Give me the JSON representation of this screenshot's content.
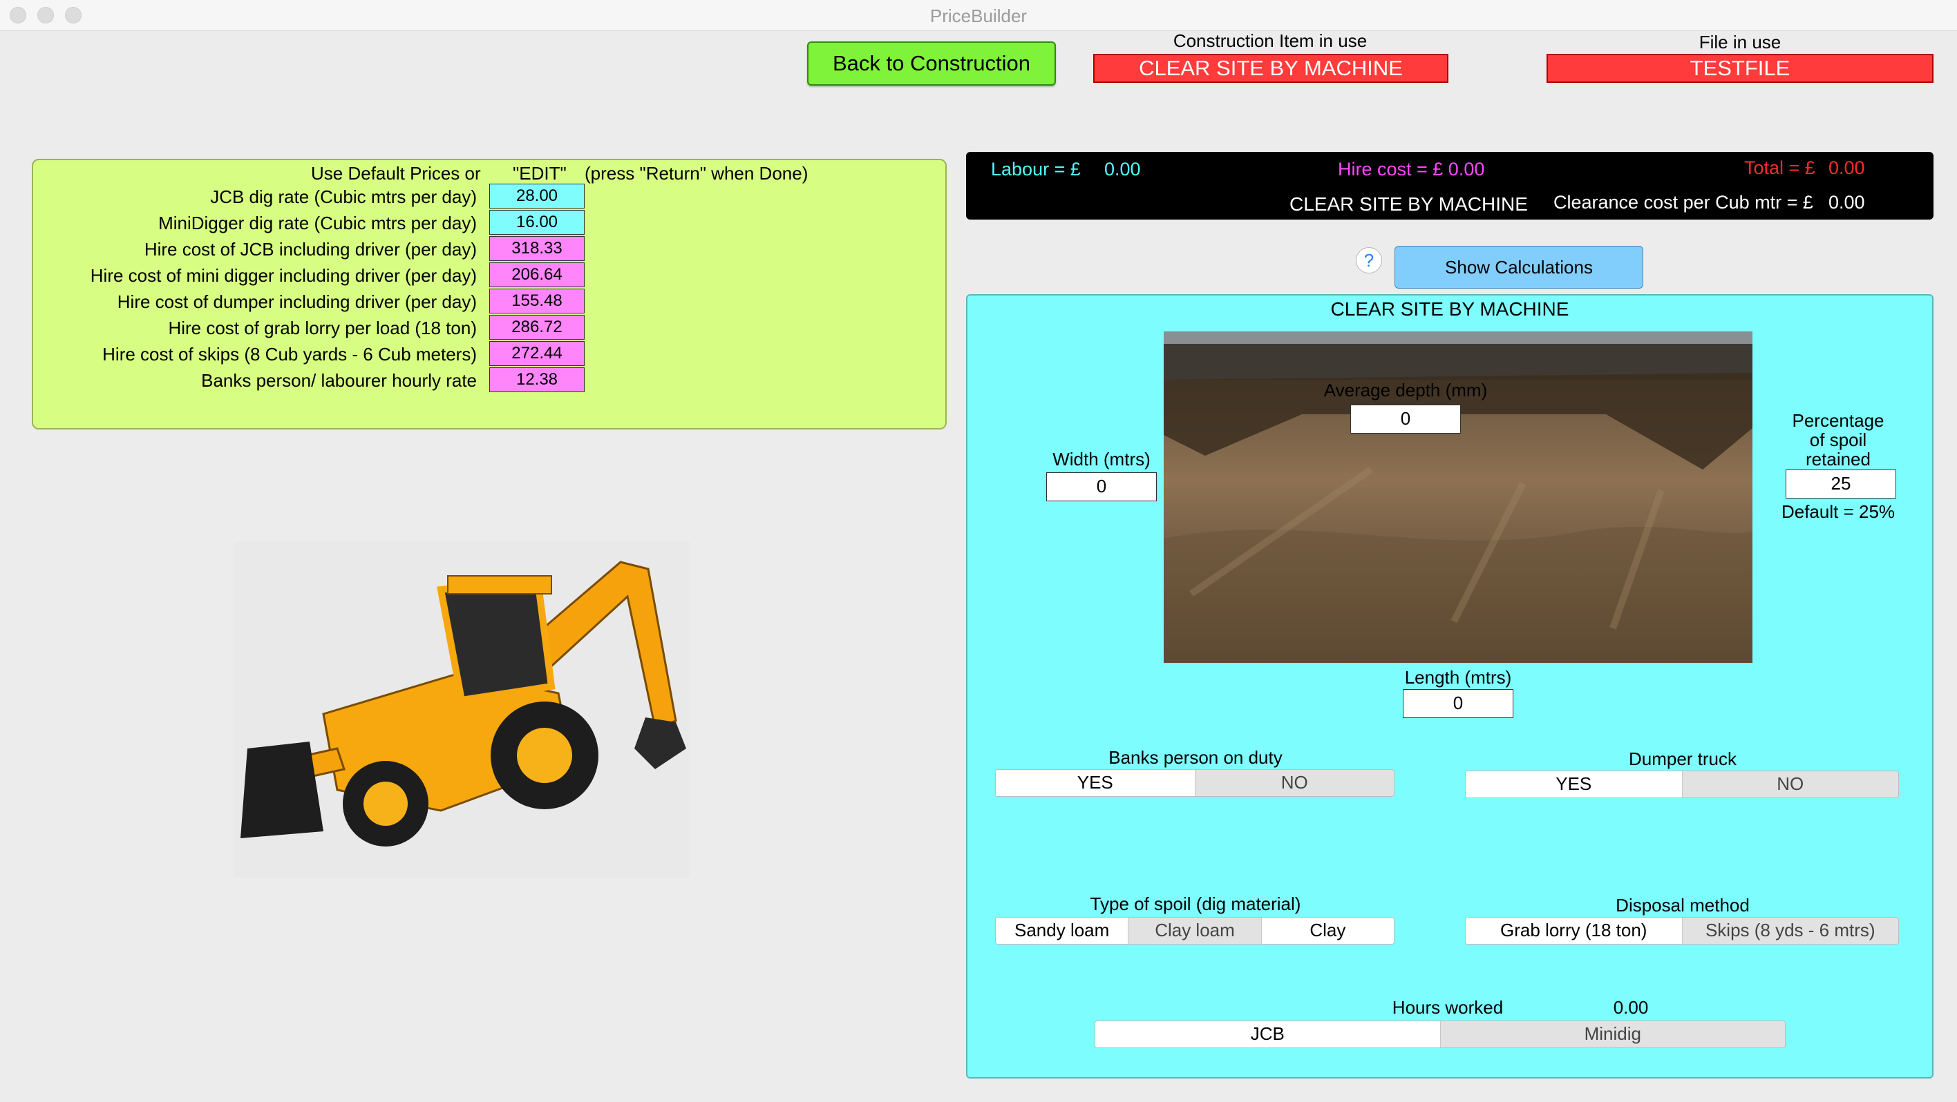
{
  "window": {
    "title": "PriceBuilder"
  },
  "header": {
    "back_button": "Back to Construction",
    "construction_item_label": "Construction Item in use",
    "construction_item_value": "CLEAR SITE BY MACHINE",
    "file_label": "File in use",
    "file_value": "TESTFILE"
  },
  "prices": {
    "header_left": "Use Default Prices or",
    "header_edit": "\"EDIT\"",
    "header_hint": "(press \"Return\" when Done)",
    "rows": [
      {
        "label": "JCB dig rate (Cubic mtrs per day)",
        "value": "28.00"
      },
      {
        "label": "MiniDigger dig rate (Cubic mtrs per day)",
        "value": "16.00"
      },
      {
        "label": "Hire cost of JCB including driver (per day)",
        "value": "318.33"
      },
      {
        "label": "Hire cost of mini digger including driver (per day)",
        "value": "206.64"
      },
      {
        "label": "Hire cost of dumper including driver (per day)",
        "value": "155.48"
      },
      {
        "label": "Hire cost of grab lorry per load (18 ton)",
        "value": "286.72"
      },
      {
        "label": "Hire cost of skips (8 Cub yards - 6 Cub meters)",
        "value": "272.44"
      },
      {
        "label": "Banks person/ labourer hourly rate",
        "value": "12.38"
      }
    ]
  },
  "summary": {
    "labour_label": "Labour = £",
    "labour_value": "0.00",
    "hire_label": "Hire cost = £ 0.00",
    "total_label": "Total = £",
    "total_value": "0.00",
    "item_name": "CLEAR SITE BY MACHINE",
    "clearance_label": "Clearance cost per Cub mtr = £",
    "clearance_value": "0.00"
  },
  "help": {
    "glyph": "?"
  },
  "show_calc_button": "Show Calculations",
  "site": {
    "title": "CLEAR SITE BY MACHINE",
    "depth_label": "Average depth (mm)",
    "depth_value": "0",
    "width_label": "Width (mtrs)",
    "width_value": "0",
    "length_label": "Length (mtrs)",
    "length_value": "0",
    "pct_label_1": "Percentage",
    "pct_label_2": "of spoil",
    "pct_label_3": "retained",
    "pct_value": "25",
    "pct_default": "Default = 25%"
  },
  "banks": {
    "label": "Banks person on duty",
    "yes": "YES",
    "no": "NO"
  },
  "dumper": {
    "label": "Dumper truck",
    "yes": "YES",
    "no": "NO"
  },
  "spoil": {
    "label": "Type of spoil (dig material)",
    "options": [
      "Sandy loam",
      "Clay loam",
      "Clay"
    ]
  },
  "disposal": {
    "label": "Disposal method",
    "options": [
      "Grab lorry (18 ton)",
      "Skips (8 yds - 6 mtrs)"
    ]
  },
  "hours": {
    "label": "Hours worked",
    "value": "0.00",
    "options": [
      "JCB",
      "Minidig"
    ]
  },
  "colors": {
    "labour": "#50fdfd",
    "hire": "#ff47ff",
    "total": "#ff2a2a",
    "prices_panel": "#d7fe82",
    "site_panel": "#7dfdfd"
  }
}
